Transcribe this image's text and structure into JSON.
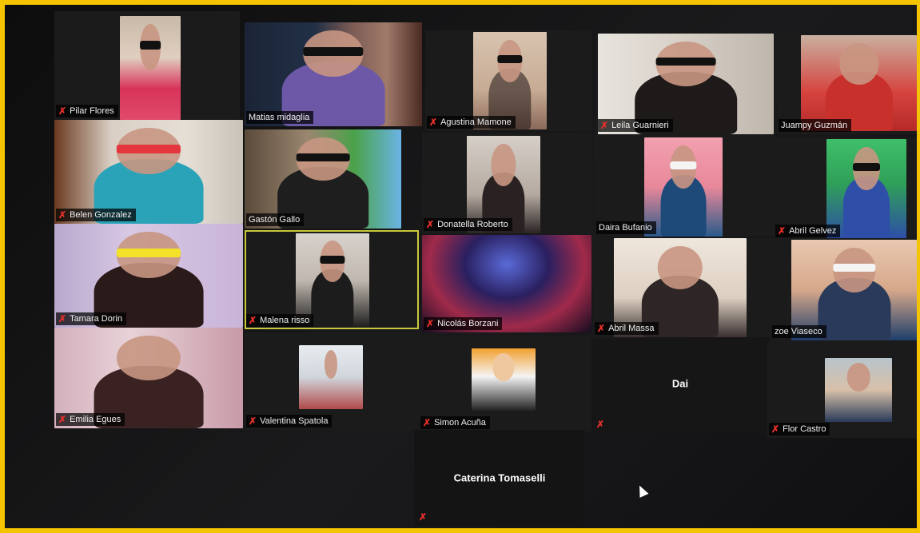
{
  "participants": [
    {
      "name": "Pilar Flores",
      "muted": true
    },
    {
      "name": "Matias midaglia",
      "muted": false
    },
    {
      "name": "Agustina Mamone",
      "muted": true
    },
    {
      "name": "Leila Guarnieri",
      "muted": true
    },
    {
      "name": "Juampy Guzmán",
      "muted": false
    },
    {
      "name": "Belen Gonzalez",
      "muted": true
    },
    {
      "name": "Gastón Gallo",
      "muted": false
    },
    {
      "name": "Donatella Roberto",
      "muted": true
    },
    {
      "name": "Daira Bufanio",
      "muted": false
    },
    {
      "name": "Abril Gelvez",
      "muted": true
    },
    {
      "name": "Tamara Dorin",
      "muted": true
    },
    {
      "name": "Malena risso",
      "muted": true
    },
    {
      "name": "Nicolás Borzani",
      "muted": true
    },
    {
      "name": "Abril Massa",
      "muted": true
    },
    {
      "name": "zoe Viaseco",
      "muted": false
    },
    {
      "name": "Emilia Egues",
      "muted": true
    },
    {
      "name": "Valentina Spatola",
      "muted": true
    },
    {
      "name": "Simon Acuña",
      "muted": true
    },
    {
      "name": "Dai",
      "muted": true
    },
    {
      "name": "Flor Castro",
      "muted": true
    },
    {
      "name": "Caterina Tomaselli",
      "muted": true
    }
  ],
  "mic_off_glyph": "✗",
  "colors": {
    "screen_frame": "#f5c400",
    "mic_off": "#e8302a",
    "active_speaker_border": "#c9c93a",
    "tile_bg": "#1b1b1b"
  }
}
